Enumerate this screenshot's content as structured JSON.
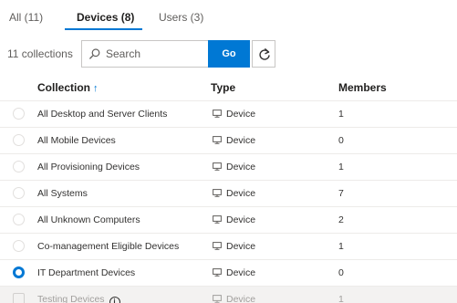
{
  "tabs": [
    {
      "label": "All (11)",
      "active": false
    },
    {
      "label": "Devices (8)",
      "active": true
    },
    {
      "label": "Users (3)",
      "active": false
    }
  ],
  "toolbar": {
    "count_label": "11 collections",
    "search_placeholder": "Search",
    "go_label": "Go"
  },
  "table": {
    "columns": [
      "Collection",
      "Type",
      "Members"
    ],
    "sort_indicator": "↑",
    "rows": [
      {
        "collection": "All Desktop and Server Clients",
        "type": "Device",
        "members": "1",
        "selected": false,
        "disabled": false
      },
      {
        "collection": "All Mobile Devices",
        "type": "Device",
        "members": "0",
        "selected": false,
        "disabled": false
      },
      {
        "collection": "All Provisioning Devices",
        "type": "Device",
        "members": "1",
        "selected": false,
        "disabled": false
      },
      {
        "collection": "All Systems",
        "type": "Device",
        "members": "7",
        "selected": false,
        "disabled": false
      },
      {
        "collection": "All Unknown Computers",
        "type": "Device",
        "members": "2",
        "selected": false,
        "disabled": false
      },
      {
        "collection": "Co-management Eligible Devices",
        "type": "Device",
        "members": "1",
        "selected": false,
        "disabled": false
      },
      {
        "collection": "IT Department Devices",
        "type": "Device",
        "members": "0",
        "selected": true,
        "disabled": false
      },
      {
        "collection": "Testing Devices",
        "type": "Device",
        "members": "1",
        "selected": false,
        "disabled": true
      }
    ]
  },
  "colors": {
    "accent": "#0078d4",
    "text": "#323130",
    "muted": "#605e5c",
    "border": "#edebe9"
  },
  "icons": {
    "search": "search-icon",
    "refresh": "refresh-icon",
    "device": "device-icon",
    "info": "info-icon",
    "sort": "sort-ascending-icon"
  }
}
